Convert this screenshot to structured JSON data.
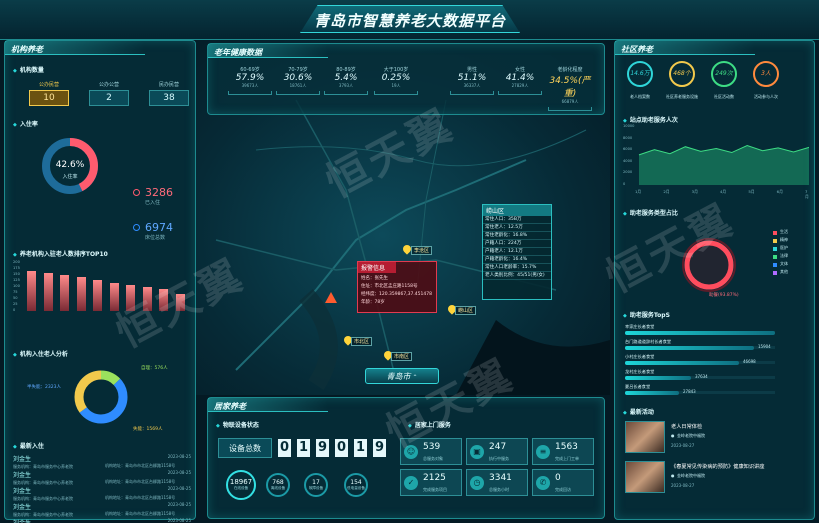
{
  "header": {
    "title": "青岛市智慧养老大数据平台"
  },
  "watermark": "恒天翼",
  "inst": {
    "title": "机构养老",
    "count_title": "机构数量",
    "counts": [
      {
        "label": "公办民营",
        "value": "10"
      },
      {
        "label": "公办公营",
        "value": "2"
      },
      {
        "label": "民办民营",
        "value": "38"
      }
    ],
    "occupancy_title": "入住率",
    "occupancy_pct": "42.6%",
    "occupancy_label": "入住率",
    "occupancy_value": 0.426,
    "occupied": "3286",
    "occupied_label": "已入住",
    "beds": "6974",
    "beds_label": "床位总数",
    "rank_title": "养老机构入驻老人数排序TOP10",
    "rank_ticks": [
      "200",
      "175",
      "150",
      "125",
      "100",
      "75",
      "50",
      "25",
      "0"
    ],
    "rank_values": [
      165,
      158,
      150,
      142,
      130,
      118,
      110,
      98,
      90,
      72
    ],
    "analysis_title": "机构入住老人分析",
    "analysis_labels": [
      "自理：576人",
      "半失能：2323人",
      "失能：1569人"
    ],
    "analysis_values": [
      576,
      2323,
      1569
    ],
    "latest_title": "最新入住",
    "latest": [
      {
        "name": "刘金生",
        "d1": "服务机构：",
        "org": "青岛市服务中心养老院",
        "date": "2023-08-25",
        "addr": "机构地址：青岛市市北区台柳路1158号"
      },
      {
        "name": "刘金生",
        "d1": "服务机构：",
        "org": "青岛市服务中心养老院",
        "date": "2023-08-25",
        "addr": "机构地址：青岛市市北区台柳路1158号"
      },
      {
        "name": "刘金生",
        "d1": "服务机构：",
        "org": "青岛市服务中心养老院",
        "date": "2023-08-25",
        "addr": "机构地址：青岛市市北区台柳路1158号"
      },
      {
        "name": "刘金生",
        "d1": "服务机构：",
        "org": "青岛市服务中心养老院",
        "date": "2023-08-25",
        "addr": "机构地址：青岛市市北区台柳路1158号"
      },
      {
        "name": "刘金生",
        "d1": "服务机构：",
        "org": "青岛市服务中心养老院",
        "date": "2023-08-25",
        "addr": "机构地址：青岛市市北区台柳路1158号"
      }
    ]
  },
  "health": {
    "title": "老年健康数据",
    "items": [
      {
        "label": "60-69岁",
        "value": "57.9%",
        "sub": "39673人"
      },
      {
        "label": "70-79岁",
        "value": "30.6%",
        "sub": "18761人"
      },
      {
        "label": "80-89岁",
        "value": "5.4%",
        "sub": "3793人"
      },
      {
        "label": "大于100岁",
        "value": "0.25%",
        "sub": "19人"
      },
      {
        "label": "男性",
        "value": "51.1%",
        "sub": "36337人"
      },
      {
        "label": "女性",
        "value": "41.4%",
        "sub": "27829人"
      },
      {
        "label": "老龄化程度",
        "value": "34.5%(严重)",
        "sub": "66879人"
      }
    ]
  },
  "map": {
    "city_button": "青岛市",
    "districts": [
      "李沧区",
      "崂山区",
      "市北区",
      "市南区"
    ],
    "alarm": {
      "title": "报警信息",
      "rows": [
        "姓名：张先生",
        "住址：市北区孟庄路1158号",
        "经纬度：120.359867,37.451478",
        "年龄：78岁"
      ]
    },
    "laoshan": {
      "title": "崂山区",
      "rows": [
        "常住人口：35B万",
        "常住老人：12.5万",
        "常住老龄化：16.8%",
        "户籍人口：224万",
        "户籍老人：12.1万",
        "户籍老龄化：16.4%",
        "常住人口老龄率：15.7%",
        "老人类别比例：45/51(男/女)"
      ]
    }
  },
  "home": {
    "title": "居家养老",
    "device_title": "物联设备状态",
    "device_total_label": "设备总数",
    "device_digits": [
      "0",
      "1",
      "9",
      "0",
      "1",
      "9"
    ],
    "device_stats": [
      {
        "value": "18967",
        "label": "在线设备"
      },
      {
        "value": "768",
        "label": "离线设备"
      },
      {
        "value": "17",
        "label": "故障设备"
      },
      {
        "value": "154",
        "label": "低电量设备"
      }
    ],
    "service_title": "居家上门服务",
    "services": [
      {
        "value": "539",
        "label": "总服务对象",
        "icon": "person-icon"
      },
      {
        "value": "247",
        "label": "执行中服务",
        "icon": "bag-icon"
      },
      {
        "value": "1563",
        "label": "完成上门工单",
        "icon": "document-icon"
      },
      {
        "value": "2125",
        "label": "完成服务项目",
        "icon": "check-icon"
      },
      {
        "value": "3341",
        "label": "总服务小时",
        "icon": "clock-icon"
      },
      {
        "value": "0",
        "label": "完成回访",
        "icon": "phone-icon"
      }
    ]
  },
  "community": {
    "title": "社区养老",
    "circles": [
      {
        "value": "14.6万",
        "label": "老人档案数",
        "color": "#2fd6d9"
      },
      {
        "value": "468个",
        "label": "社区养老服务设施",
        "color": "#f2c94c"
      },
      {
        "value": "249次",
        "label": "社区活动数",
        "color": "#3ddc84"
      },
      {
        "value": "3人",
        "label": "活动参与人次",
        "color": "#ff8a3d"
      }
    ],
    "station_title": "站点助老服务人次",
    "station_ticks": [
      "10000",
      "8000",
      "6000",
      "4000",
      "2000",
      "0"
    ],
    "station_months": [
      "1月",
      "2月",
      "3月",
      "4月",
      "5月",
      "6月",
      "7月"
    ],
    "station_values": [
      5200,
      6100,
      5400,
      6600,
      5800,
      6300,
      5600,
      6800,
      5900,
      6400,
      5700,
      6500
    ],
    "types_title": "助老服务类型占比",
    "types_legend": [
      "生活",
      "精神",
      "医护",
      "法律",
      "文体",
      "其他"
    ],
    "types_note": "助餐(93.87%)",
    "top5_title": "助老服务TopS",
    "top5": [
      {
        "name": "幸家庄长者食堂",
        "value": "",
        "pct": 1.0
      },
      {
        "name": "台门路道道辞村长者食堂",
        "value": "15904",
        "pct": 0.86
      },
      {
        "name": "小村庄长者食堂",
        "value": "46698",
        "pct": 0.76
      },
      {
        "name": "龙村庄长者食堂",
        "value": "37634",
        "pct": 0.44
      },
      {
        "name": "夏吕长者食堂",
        "value": "27843",
        "pct": 0.36
      }
    ],
    "news_title": "最新活动",
    "news": [
      {
        "title": "老人日常体检",
        "org": "金岭老院中福院",
        "date": "2023-08-27"
      },
      {
        "title": "《春夏常见传染病的预防》健康知识讲座",
        "org": "金岭老院中福院",
        "date": "2023-08-27"
      }
    ]
  }
}
